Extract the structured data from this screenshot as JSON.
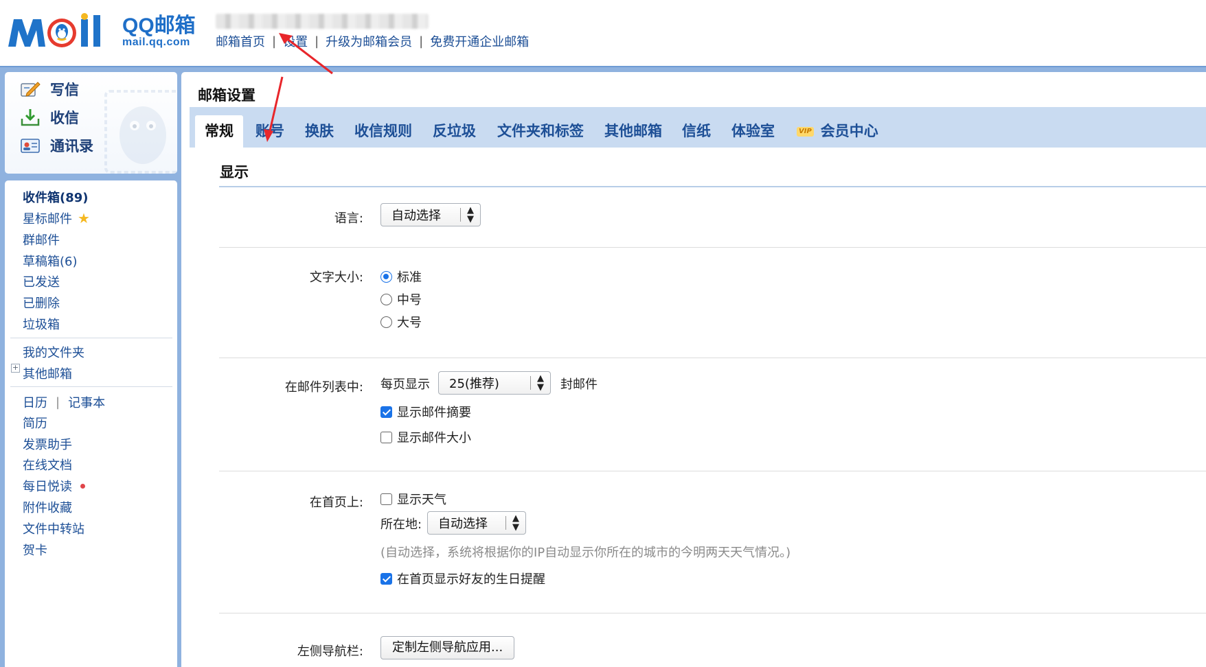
{
  "brand": {
    "logo_word": "Mail",
    "name": "QQ邮箱",
    "domain": "mail.qq.com"
  },
  "top_links": [
    "邮箱首页",
    "设置",
    "升级为邮箱会员",
    "免费开通企业邮箱"
  ],
  "nav_actions": [
    {
      "label": "写信",
      "icon": "compose-icon"
    },
    {
      "label": "收信",
      "icon": "inbox-download-icon"
    },
    {
      "label": "通讯录",
      "icon": "contacts-card-icon"
    }
  ],
  "folders": {
    "inbox": "收件箱(89)",
    "starred": "星标邮件",
    "group": "群邮件",
    "drafts": "草稿箱(6)",
    "sent": "已发送",
    "deleted": "已删除",
    "spam": "垃圾箱",
    "my_folders": "我的文件夹",
    "other_mailboxes": "其他邮箱"
  },
  "apps": {
    "calendar": "日历",
    "calendar_sep": "|",
    "notepad": "记事本",
    "resume": "简历",
    "invoice": "发票助手",
    "docs": "在线文档",
    "daily_read": "每日悦读",
    "attachments": "附件收藏",
    "file_transfer": "文件中转站",
    "cards": "贺卡"
  },
  "settings": {
    "title": "邮箱设置",
    "tabs": [
      "常规",
      "账号",
      "换肤",
      "收信规则",
      "反垃圾",
      "文件夹和标签",
      "其他邮箱",
      "信纸",
      "体验室",
      "会员中心"
    ],
    "vip_badge": "VIP",
    "active_tab": "常规",
    "section_title": "显示",
    "language": {
      "label": "语言:",
      "value": "自动选择"
    },
    "font_size": {
      "label": "文字大小:",
      "options": [
        "标准",
        "中号",
        "大号"
      ],
      "selected": "标准"
    },
    "mail_list": {
      "label": "在邮件列表中:",
      "per_page_prefix": "每页显示",
      "per_page_value": "25(推荐)",
      "per_page_suffix": "封邮件",
      "show_summary": {
        "label": "显示邮件摘要",
        "checked": true
      },
      "show_size": {
        "label": "显示邮件大小",
        "checked": false
      }
    },
    "home_page": {
      "label": "在首页上:",
      "show_weather": {
        "label": "显示天气",
        "checked": false
      },
      "location_label": "所在地:",
      "location_value": "自动选择",
      "hint": "(自动选择，系统将根据你的IP自动显示你所在的城市的今明两天天气情况。)",
      "birthday": {
        "label": "在首页显示好友的生日提醒",
        "checked": true
      }
    },
    "left_nav": {
      "label": "左侧导航栏:",
      "button": "定制左侧导航应用..."
    }
  },
  "colors": {
    "frame_blue": "#8fb2df",
    "tab_bar": "#c9dbf1",
    "link_blue": "#1d4f96",
    "accent_blue": "#1a73e8",
    "annotation_red": "#e8262b"
  }
}
